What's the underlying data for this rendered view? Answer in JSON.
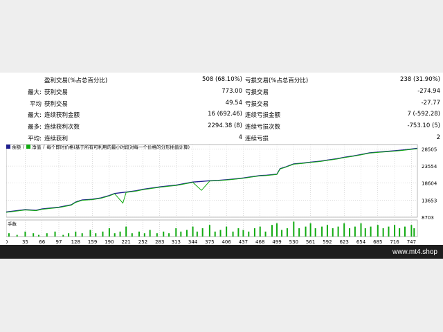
{
  "stats": [
    {
      "prefix": "",
      "label1": "盈利交易(%占总百分比)",
      "value1": "508 (68.10%)",
      "label2": "亏损交易(%占总百分比)",
      "value2": "238 (31.90%)"
    },
    {
      "prefix": "最大:",
      "label1": "获利交易",
      "value1": "773.00",
      "label2": "亏损交易",
      "value2": "-274.94"
    },
    {
      "prefix": "平均",
      "label1": "获利交易",
      "value1": "49.54",
      "label2": "亏损交易",
      "value2": "-27.77"
    },
    {
      "prefix": "最大:",
      "label1": "连续获利金额",
      "value1": "16 (692.46)",
      "label2": "连续亏损金额",
      "value2": "7 (-592.28)"
    },
    {
      "prefix": "最多:",
      "label1": "连续获利次数",
      "value1": "2294.38 (8)",
      "label2": "连续亏损次数",
      "value2": "-753.10 (5)"
    },
    {
      "prefix": "平均:",
      "label1": "连续获利",
      "value1": "4",
      "label2": "连续亏损",
      "value2": "2"
    }
  ],
  "chart": {
    "legend": {
      "balance": "余额",
      "sep1": "/",
      "equity": "净值",
      "sep2": "/",
      "note": "每个即时价格(基于所有可利用的最小时段对每一个价格的分形插值计算)"
    },
    "volume_label": "手数",
    "colors": {
      "balance": "#1f1f8f",
      "equity": "#11aa11",
      "volume": "#11aa11",
      "grid": "#bbbbbb"
    }
  },
  "chart_data": {
    "type": "line",
    "y_ticks": [
      8703,
      13653,
      18604,
      23554,
      28505
    ],
    "ylim": [
      8703,
      29800
    ],
    "x_ticks": [
      0,
      35,
      66,
      97,
      128,
      159,
      190,
      221,
      252,
      283,
      313,
      344,
      375,
      406,
      437,
      468,
      499,
      530,
      561,
      592,
      623,
      654,
      685,
      716,
      747
    ],
    "xlim": [
      0,
      758
    ],
    "series": [
      {
        "key": "balance",
        "x": [
          0,
          35,
          55,
          66,
          97,
          120,
          128,
          140,
          159,
          175,
          190,
          200,
          221,
          240,
          252,
          270,
          283,
          300,
          313,
          330,
          344,
          360,
          375,
          390,
          406,
          420,
          437,
          450,
          468,
          480,
          499,
          505,
          515,
          530,
          545,
          561,
          580,
          592,
          610,
          623,
          640,
          654,
          670,
          685,
          700,
          716,
          730,
          747,
          758
        ],
        "y": [
          10200,
          10900,
          10700,
          11100,
          11600,
          12300,
          13100,
          13700,
          13900,
          14300,
          15000,
          15600,
          16000,
          16400,
          16800,
          17200,
          17500,
          17800,
          18000,
          18500,
          18900,
          19100,
          19300,
          19400,
          19600,
          19800,
          20100,
          20400,
          20800,
          20900,
          21200,
          22800,
          23300,
          24200,
          24400,
          24700,
          25000,
          25300,
          25700,
          26100,
          26500,
          26900,
          27400,
          27600,
          27800,
          28000,
          28200,
          28500,
          28700
        ]
      },
      {
        "key": "equity",
        "x": [
          0,
          35,
          55,
          66,
          97,
          120,
          128,
          140,
          159,
          175,
          190,
          200,
          215,
          221,
          240,
          252,
          270,
          283,
          300,
          313,
          330,
          344,
          360,
          375,
          390,
          406,
          420,
          437,
          450,
          468,
          480,
          499,
          505,
          515,
          530,
          545,
          561,
          580,
          592,
          610,
          623,
          640,
          654,
          670,
          685,
          700,
          716,
          730,
          747,
          758
        ],
        "y": [
          10100,
          10800,
          10600,
          11000,
          11500,
          12200,
          13000,
          13600,
          13800,
          14200,
          14900,
          15500,
          12800,
          15900,
          16300,
          16700,
          17100,
          17400,
          17700,
          17900,
          18400,
          18800,
          16500,
          19200,
          19300,
          19500,
          19700,
          20000,
          20300,
          20700,
          20800,
          21100,
          22700,
          23200,
          24100,
          24300,
          24600,
          24900,
          25200,
          25600,
          26000,
          26400,
          26800,
          27300,
          27500,
          27700,
          27900,
          28100,
          28400,
          28600
        ]
      }
    ],
    "volume": {
      "ylim": [
        0,
        10
      ],
      "x": [
        5,
        20,
        35,
        50,
        60,
        75,
        90,
        105,
        115,
        128,
        140,
        155,
        165,
        178,
        190,
        200,
        210,
        221,
        232,
        245,
        255,
        265,
        278,
        290,
        300,
        313,
        322,
        333,
        344,
        352,
        362,
        375,
        385,
        395,
        406,
        418,
        428,
        437,
        447,
        458,
        468,
        478,
        490,
        499,
        508,
        518,
        530,
        540,
        552,
        561,
        570,
        582,
        592,
        602,
        612,
        623,
        633,
        643,
        654,
        662,
        672,
        685,
        695,
        705,
        716,
        725,
        735,
        747,
        752
      ],
      "v": [
        2,
        1,
        3,
        2,
        1,
        2,
        3,
        1,
        2,
        3,
        2,
        4,
        2,
        3,
        5,
        2,
        3,
        6,
        2,
        3,
        2,
        4,
        2,
        3,
        2,
        5,
        3,
        4,
        6,
        3,
        5,
        7,
        3,
        4,
        6,
        3,
        5,
        4,
        3,
        5,
        6,
        3,
        7,
        8,
        4,
        5,
        9,
        5,
        6,
        8,
        5,
        6,
        7,
        5,
        6,
        8,
        5,
        6,
        8,
        5,
        6,
        7,
        5,
        6,
        7,
        5,
        6,
        7,
        5
      ]
    }
  },
  "footer": {
    "url": "www.mt4.shop"
  }
}
